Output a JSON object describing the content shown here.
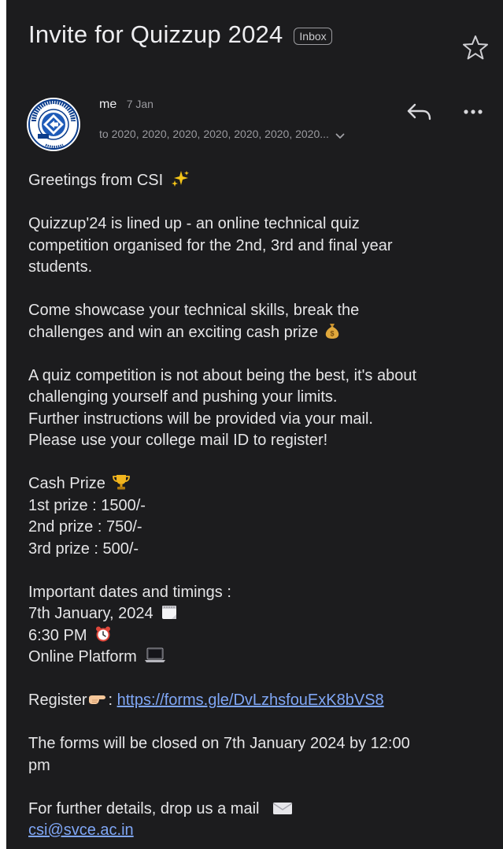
{
  "email": {
    "subject": "Invite for Quizzup 2024",
    "label": "Inbox",
    "sender": "me",
    "date": "7 Jan",
    "recipients": "to 2020, 2020, 2020, 2020, 2020, 2020, 2020..."
  },
  "avatar": {
    "org_text": "COMPUTER SOCIETY OF INDIA",
    "estd": "ESTD. 1965",
    "colors": {
      "ring": "#0b3d8c",
      "fill": "#ffffff"
    }
  },
  "icons": {
    "star": "star-outline-icon",
    "reply": "reply-icon",
    "more": "more-horizontal-icon",
    "chevron": "chevron-down-icon"
  },
  "body": {
    "greeting": "Greetings from CSI",
    "intro": [
      "Quizzup'24 is lined up - an online technical quiz",
      "competition organised for the 2nd, 3rd and final year",
      "students."
    ],
    "showcase": [
      "Come showcase your technical skills, break the",
      "challenges and win an exciting cash prize"
    ],
    "motto": [
      "A quiz competition is not about being the best, it's about",
      "challenging yourself and pushing your limits.",
      "Further instructions will be provided via your mail.",
      "Please use your college mail ID to register!"
    ],
    "prizes": {
      "heading": "Cash Prize",
      "items": [
        "1st prize : 1500/-",
        "2nd prize : 750/-",
        "3rd prize : 500/-"
      ]
    },
    "schedule": {
      "heading": "Important dates and timings :",
      "date": "7th January, 2024",
      "time": "6:30 PM",
      "platform": "Online Platform"
    },
    "register": {
      "label": "Register",
      "separator": ":",
      "url": "https://forms.gle/DvLzhsfouExK8bVS8"
    },
    "closing": [
      "The forms will be closed on 7th January 2024 by 12:00",
      "pm"
    ],
    "contact": {
      "text": "For further details, drop us a mail",
      "email": "csi@svce.ac.in"
    }
  },
  "colors": {
    "background": "#1c1c1e",
    "text": "#e5e5e7",
    "secondary": "#9a9a9f",
    "link": "#7fa6f5"
  }
}
